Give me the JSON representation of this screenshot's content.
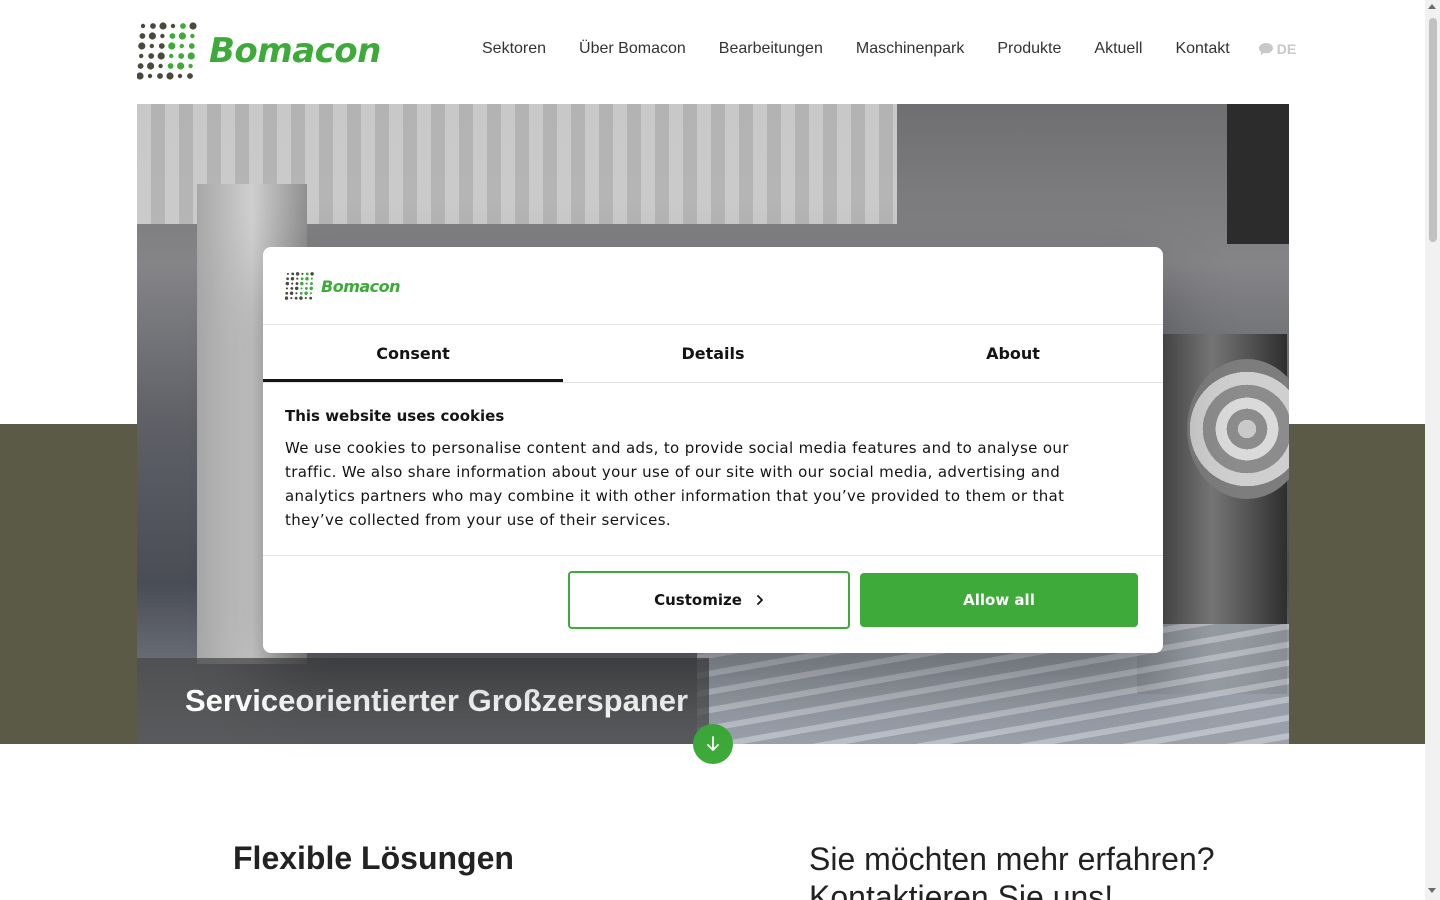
{
  "brand": {
    "name": "Bomacon",
    "accent_color": "#3daa3a",
    "dark_dot_color": "#4a4a3c"
  },
  "nav": {
    "items": [
      "Sektoren",
      "Über Bomacon",
      "Bearbeitungen",
      "Maschinenpark",
      "Produkte",
      "Aktuell",
      "Kontakt"
    ],
    "language": "DE",
    "language_icon": "speech-bubble-icon"
  },
  "hero": {
    "caption": "Serviceorientierter Großzerspaner",
    "band_color": "#5a5a47",
    "scroll_icon": "arrow-down-icon"
  },
  "content": {
    "left_heading": "Flexible Lösungen",
    "right_heading_line1": "Sie möchten mehr erfahren?",
    "right_heading_line2": "Kontaktieren Sie uns!"
  },
  "cookie_dialog": {
    "logo_text": "Bomacon",
    "tabs": [
      "Consent",
      "Details",
      "About"
    ],
    "active_tab": "Consent",
    "title": "This website uses cookies",
    "body": "We use cookies to personalise content and ads, to provide social media features and to analyse our traffic. We also share information about your use of our site with our social media, advertising and analytics partners who may combine it with other information that you’ve provided to them or that they’ve collected from your use of their services.",
    "customize_label": "Customize",
    "allow_all_label": "Allow all"
  }
}
